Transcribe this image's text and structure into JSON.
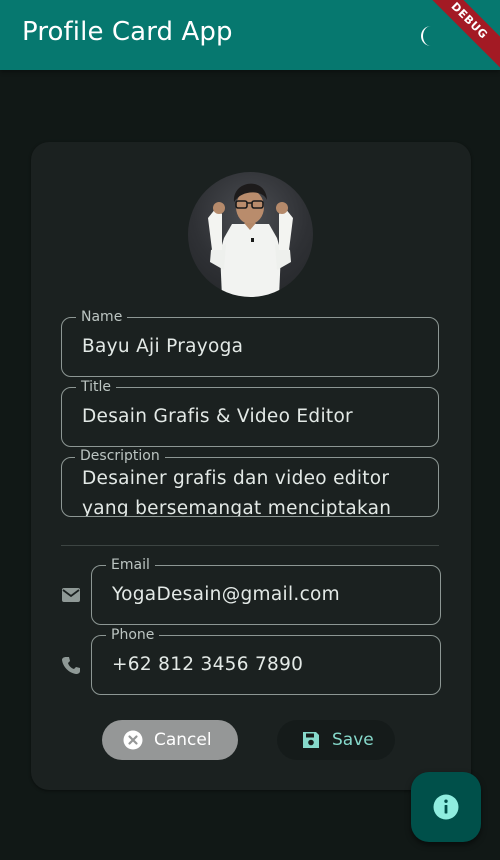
{
  "app_bar": {
    "title": "Profile Card App",
    "theme_toggle_icon": "dark-mode-moon-icon",
    "debug_banner": "DEBUG",
    "color": "#06786f"
  },
  "profile": {
    "avatar_icon": "profile-photo",
    "fields": {
      "name": {
        "label": "Name",
        "value": "Bayu Aji Prayoga"
      },
      "title": {
        "label": "Title",
        "value": "Desain Grafis & Video Editor"
      },
      "description": {
        "label": "Description",
        "value": "Desainer grafis dan video editor yang bersemangat menciptakan"
      },
      "email": {
        "label": "Email",
        "value": "YogaDesain@gmail.com",
        "icon": "email-icon"
      },
      "phone": {
        "label": "Phone",
        "value": "+62 812 3456 7890",
        "icon": "phone-icon"
      }
    }
  },
  "actions": {
    "cancel_label": "Cancel",
    "cancel_icon": "cancel-circle-icon",
    "save_label": "Save",
    "save_icon": "save-icon"
  },
  "fab": {
    "icon": "info-icon",
    "color": "#00504a"
  }
}
